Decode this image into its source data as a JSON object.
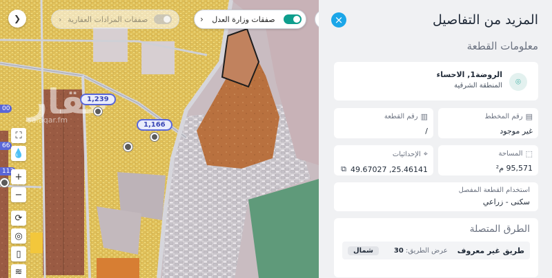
{
  "map": {
    "toggle_label": "صفقات وزارة العدل",
    "faded_chip_label": "صفقات المزادات العقارية",
    "price_pins": [
      "1,239",
      "1,166"
    ],
    "edge_tags": [
      "00",
      "66",
      "113"
    ],
    "watermark": {
      "logo": "عقار",
      "url": "sa.aqar.fm"
    },
    "tools": [
      "fullscreen-icon",
      "drop-icon",
      "zoom-in-icon",
      "zoom-out-icon",
      "compass-icon",
      "locate-icon",
      "phone-icon",
      "layers-icon"
    ]
  },
  "panel": {
    "title": "المزيد من التفاصيل",
    "section_title": "معلومات القطعة",
    "location": {
      "line1": "الروضة1, الاحساء",
      "line2": "المنطقة الشرقية"
    },
    "plan": {
      "label": "رقم المخطط",
      "value": "غير موجود"
    },
    "plot": {
      "label": "رقم القطعة",
      "value": "/"
    },
    "area": {
      "label": "المساحة",
      "value": "95,571 م²"
    },
    "coords": {
      "label": "الإحداثيات",
      "value": "49.67027 ,25.46141"
    },
    "land_use": {
      "label": "استخدام القطعة المفصل",
      "value": "سكنى - زراعي"
    },
    "roads": {
      "title": "الطرق المتصلة",
      "items": [
        {
          "name": "طريق غير معروف",
          "width_label": "عرض الطريق:",
          "width_value": "30",
          "direction": "شمال"
        }
      ]
    }
  },
  "colors": {
    "accent": "#1ba6e8",
    "teal": "#0e9e8d",
    "pin": "#5a67d8",
    "highlight_lot": "#c1825e"
  }
}
